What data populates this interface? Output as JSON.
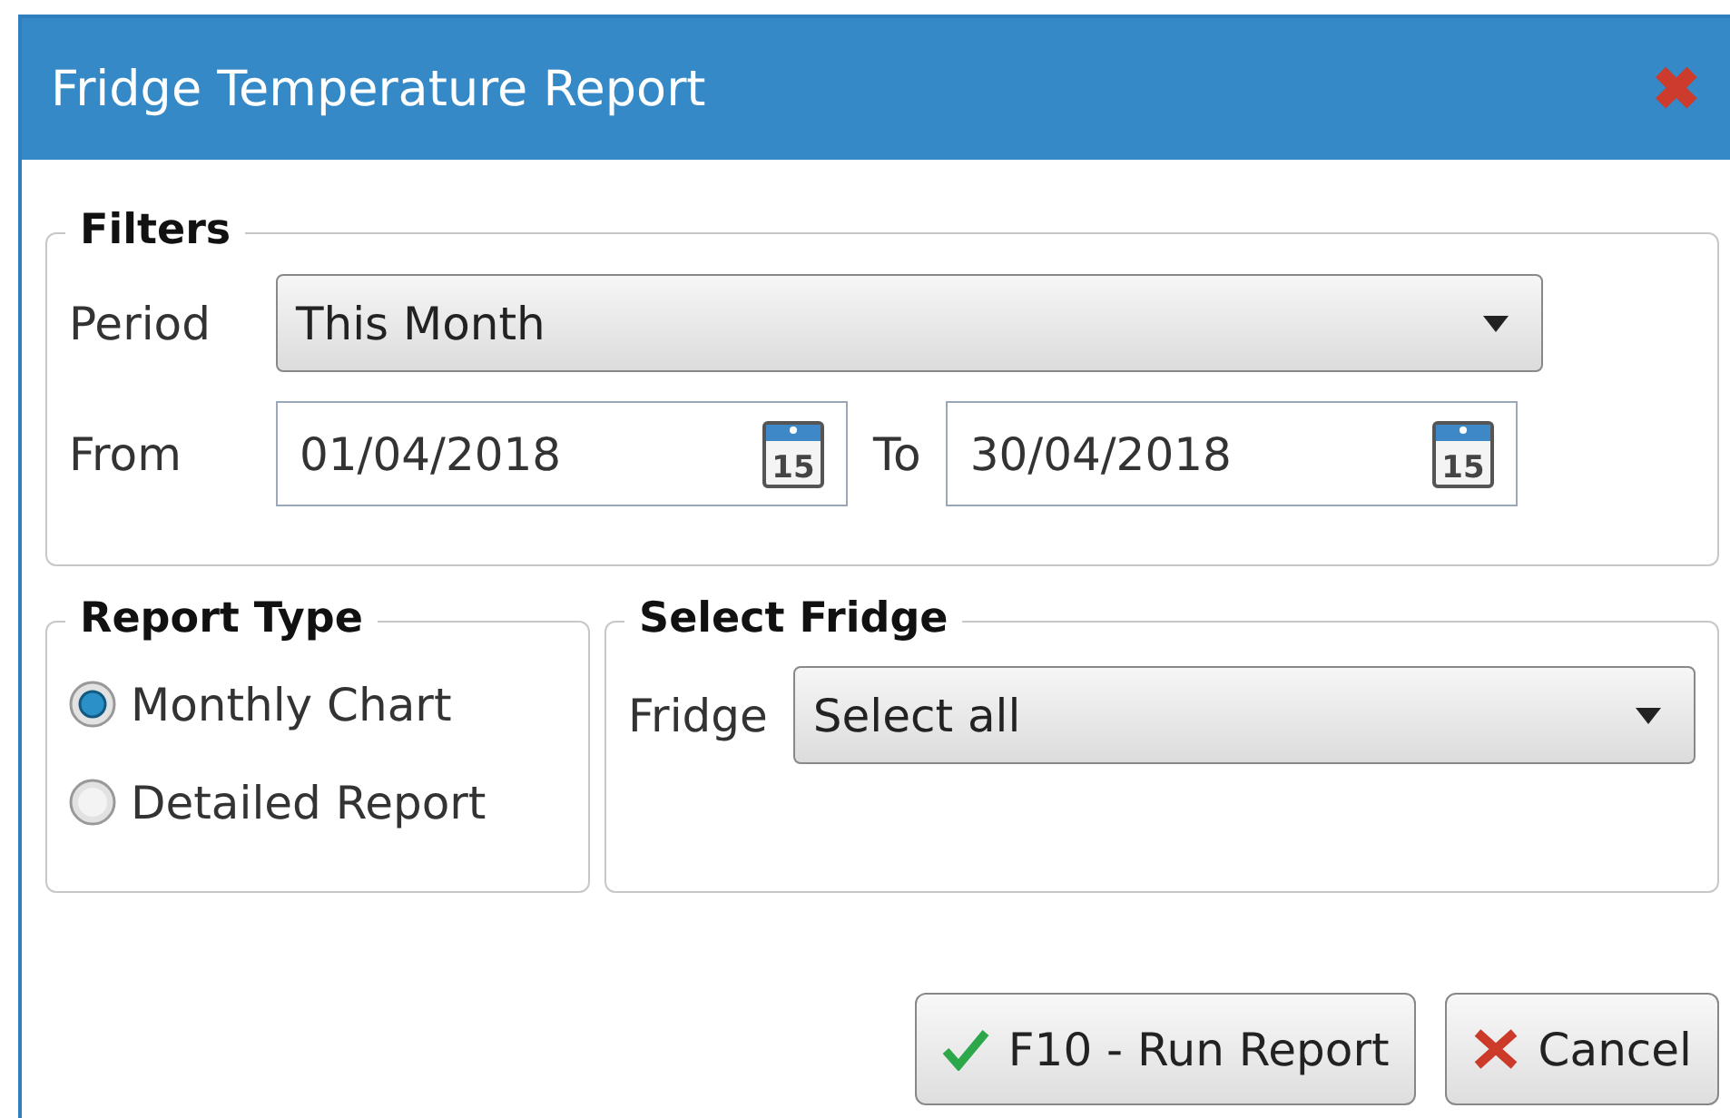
{
  "window": {
    "title": "Fridge Temperature Report",
    "close": "✖"
  },
  "filters": {
    "legend": "Filters",
    "period": {
      "label": "Period",
      "value": "This Month"
    },
    "from": {
      "label": "From",
      "value": "01/04/2018",
      "calendar_day": "15"
    },
    "to": {
      "label": "To",
      "value": "30/04/2018",
      "calendar_day": "15"
    }
  },
  "report_type": {
    "legend": "Report Type",
    "options": [
      {
        "label": "Monthly Chart",
        "selected": true
      },
      {
        "label": "Detailed Report",
        "selected": false
      }
    ]
  },
  "select_fridge": {
    "legend": "Select Fridge",
    "fridge": {
      "label": "Fridge",
      "value": "Select all"
    }
  },
  "buttons": [
    {
      "kind": "ok",
      "label": "F10 -  Run Report"
    },
    {
      "kind": "cancel",
      "label": "Cancel"
    }
  ]
}
